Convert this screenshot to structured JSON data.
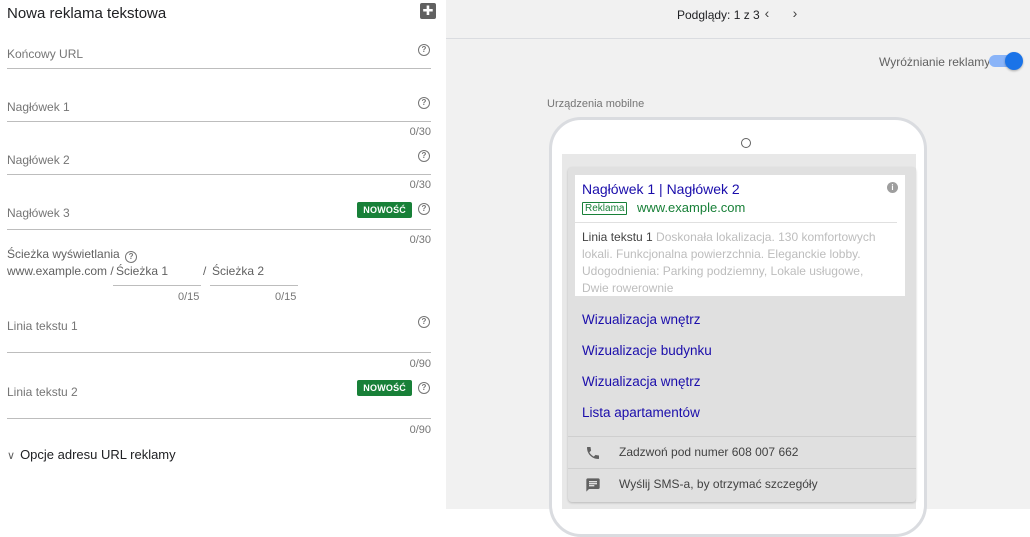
{
  "editor": {
    "title": "Nowa reklama tekstowa",
    "ext_icon": "add-extension-icon",
    "fields": {
      "final_url": {
        "label": "Końcowy URL"
      },
      "headline1": {
        "label": "Nagłówek 1",
        "count": "0/30"
      },
      "headline2": {
        "label": "Nagłówek 2",
        "count": "0/30"
      },
      "headline3": {
        "label": "Nagłówek 3",
        "count": "0/30",
        "badge": "NOWOŚĆ"
      },
      "display_path": {
        "label": "Ścieżka wyświetlania",
        "prefix": "www.example.com / ",
        "path1": "Ścieżka 1",
        "path1_count": "0/15",
        "separator": "/",
        "path2": "Ścieżka 2",
        "path2_count": "0/15"
      },
      "desc1": {
        "label": "Linia tekstu 1",
        "count": "0/90"
      },
      "desc2": {
        "label": "Linia tekstu 2",
        "count": "0/90",
        "badge": "NOWOŚĆ"
      }
    },
    "url_options": "Opcje adresu URL reklamy"
  },
  "preview": {
    "count_text": "Podglądy: 1 z 3",
    "prev_icon": "chevron-left-icon",
    "next_icon": "chevron-right-icon",
    "highlight_label": "Wyróżnianie reklamy",
    "highlight_on": true,
    "device_label": "Urządzenia mobilne",
    "ad": {
      "headline": "Nagłówek 1 | Nagłówek 2",
      "badge": "Reklama",
      "url": "www.example.com",
      "desc_strong": "Linia tekstu 1",
      "desc_rest": " Doskonała lokalizacja. 130 komfortowych lokali. Funkcjonalna powierzchnia. Eleganckie lobby. Udogodnienia: Parking podziemny, Lokale usługowe, Dwie rowerownie",
      "sitelinks": [
        "Wizualizacja wnętrz",
        "Wizualizacje budynku",
        "Wizualizacja wnętrz",
        "Lista apartamentów"
      ],
      "call_text": "Zadzwoń pod numer 608 007 662",
      "sms_text": "Wyślij SMS-a, by otrzymać szczegóły"
    }
  },
  "colors": {
    "accent": "#1a73e8",
    "badge_green": "#188038",
    "link": "#1a0dab"
  }
}
